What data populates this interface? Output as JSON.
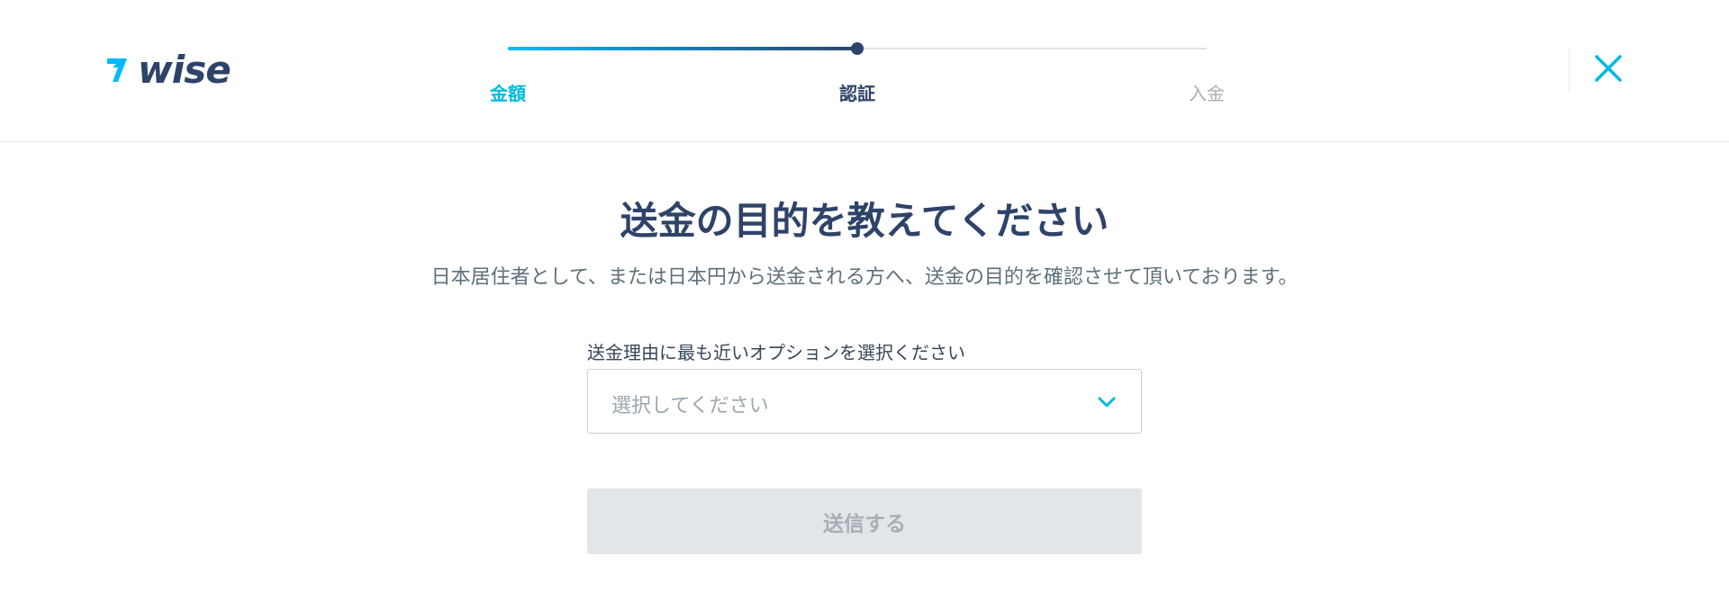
{
  "brand": {
    "name": "wise",
    "icon": "wise-flag-icon",
    "color": "#2e4369",
    "accent": "#00b9ff"
  },
  "stepper": {
    "progress": 0.5,
    "steps": [
      {
        "label": "金額",
        "state": "done"
      },
      {
        "label": "認証",
        "state": "current"
      },
      {
        "label": "入金",
        "state": "todo"
      }
    ]
  },
  "header": {
    "close_icon": "close-icon"
  },
  "main": {
    "title": "送金の目的を教えてください",
    "subtitle": "日本居住者として、または日本円から送金される方へ、送金の目的を確認させて頂いております。",
    "purpose_field": {
      "label": "送金理由に最も近いオプションを選択ください",
      "placeholder": "選択してください",
      "icon": "chevron-down-icon"
    },
    "submit_label": "送信する"
  },
  "colors": {
    "done_step": "#00b9e1",
    "current_step": "#2e4369",
    "todo_step": "#a7afb5",
    "disabled_button": "#e2e6e8"
  }
}
